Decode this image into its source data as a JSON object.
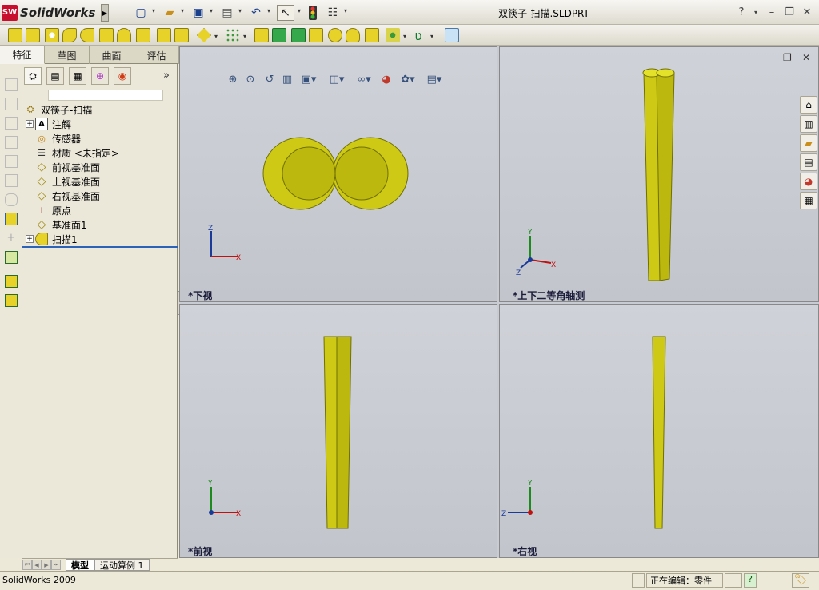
{
  "app": {
    "logo_text": "SolidWorks",
    "logo_badge": "SW",
    "document_title": "双筷子-扫描.SLDPRT"
  },
  "window_controls": {
    "help": "?",
    "minimize": "–",
    "restore": "❐",
    "close": "✕"
  },
  "quick_access": [
    {
      "icon": "new-document-icon",
      "glyph": "▢"
    },
    {
      "icon": "open-folder-icon",
      "glyph": "📂"
    },
    {
      "icon": "save-icon",
      "glyph": "💾"
    },
    {
      "icon": "print-icon",
      "glyph": "🖶"
    },
    {
      "icon": "undo-icon",
      "glyph": "↶"
    },
    {
      "icon": "select-arrow-icon",
      "glyph": "↖"
    },
    {
      "icon": "traffic-light-rebuild-icon",
      "glyph": "⬛"
    },
    {
      "icon": "options-icon",
      "glyph": "☷"
    }
  ],
  "tabs": [
    "特征",
    "草图",
    "曲面",
    "评估"
  ],
  "tree": {
    "root": "双筷子-扫描",
    "items": [
      {
        "label": "注解",
        "icon": "annotation-icon",
        "glyph": "A",
        "expandable": true
      },
      {
        "label": "传感器",
        "icon": "sensor-icon",
        "glyph": "◎",
        "expandable": false
      },
      {
        "label": "材质 <未指定>",
        "icon": "material-icon",
        "glyph": "☰",
        "expandable": false
      },
      {
        "label": "前视基准面",
        "icon": "plane-icon",
        "glyph": "◇",
        "expandable": false
      },
      {
        "label": "上视基准面",
        "icon": "plane-icon",
        "glyph": "◇",
        "expandable": false
      },
      {
        "label": "右视基准面",
        "icon": "plane-icon",
        "glyph": "◇",
        "expandable": false
      },
      {
        "label": "原点",
        "icon": "origin-icon",
        "glyph": "⊥",
        "expandable": false
      },
      {
        "label": "基准面1",
        "icon": "plane-icon",
        "glyph": "◇",
        "expandable": false
      },
      {
        "label": "扫描1",
        "icon": "sweep-feature-icon",
        "glyph": "⌒",
        "expandable": true
      }
    ]
  },
  "bottom_tabs": [
    "模型",
    "运动算例 1"
  ],
  "viewports": [
    {
      "label": "*下视",
      "axes": {
        "a": "Z",
        "b": "X"
      }
    },
    {
      "label": "*上下二等角轴测",
      "axes": {
        "a": "Y",
        "b": "X",
        "c": "Z"
      }
    },
    {
      "label": "*前视",
      "axes": {
        "a": "Y",
        "b": "X"
      }
    },
    {
      "label": "*右视",
      "axes": {
        "a": "Y",
        "b": "Z"
      }
    }
  ],
  "status": {
    "app_version": "SolidWorks 2009",
    "editing": "正在编辑：零件",
    "help_glyph": "?"
  },
  "colors": {
    "model_yellow": "#d6d51a",
    "model_dark": "#8a8a08",
    "viewport_bg": "#c8ccd2"
  }
}
